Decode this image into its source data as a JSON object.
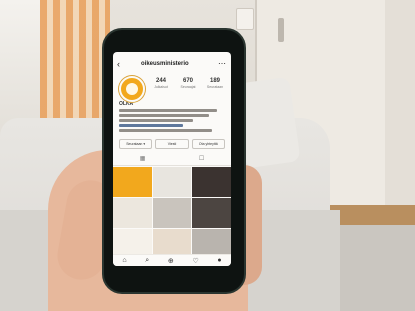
{
  "profile": {
    "username": "oikeusministerio",
    "display_name": "OLKA",
    "stats": [
      {
        "num": "244",
        "label": "Julkaisut"
      },
      {
        "num": "670",
        "label": "Seuraajat"
      },
      {
        "num": "189",
        "label": "Seurataan"
      }
    ],
    "actions": [
      "Seurataan ▾",
      "Viesti",
      "Ota yhteyttä"
    ]
  },
  "icons": {
    "back": "‹",
    "more": "⋯",
    "grid_tab": "▦",
    "tagged_tab": "☐",
    "nav": [
      "⌂",
      "⌕",
      "⊕",
      "♡",
      "●"
    ]
  },
  "colors": {
    "avatar": "#f2a81d",
    "curtain": "#e9a15e",
    "posts": [
      "#f2a81d",
      "#e8e5df",
      "#3b3330",
      "#ece7de",
      "#c9c4bd",
      "#4c4541",
      "#f5f1ea",
      "#e8dccd",
      "#b9b4ae"
    ]
  }
}
